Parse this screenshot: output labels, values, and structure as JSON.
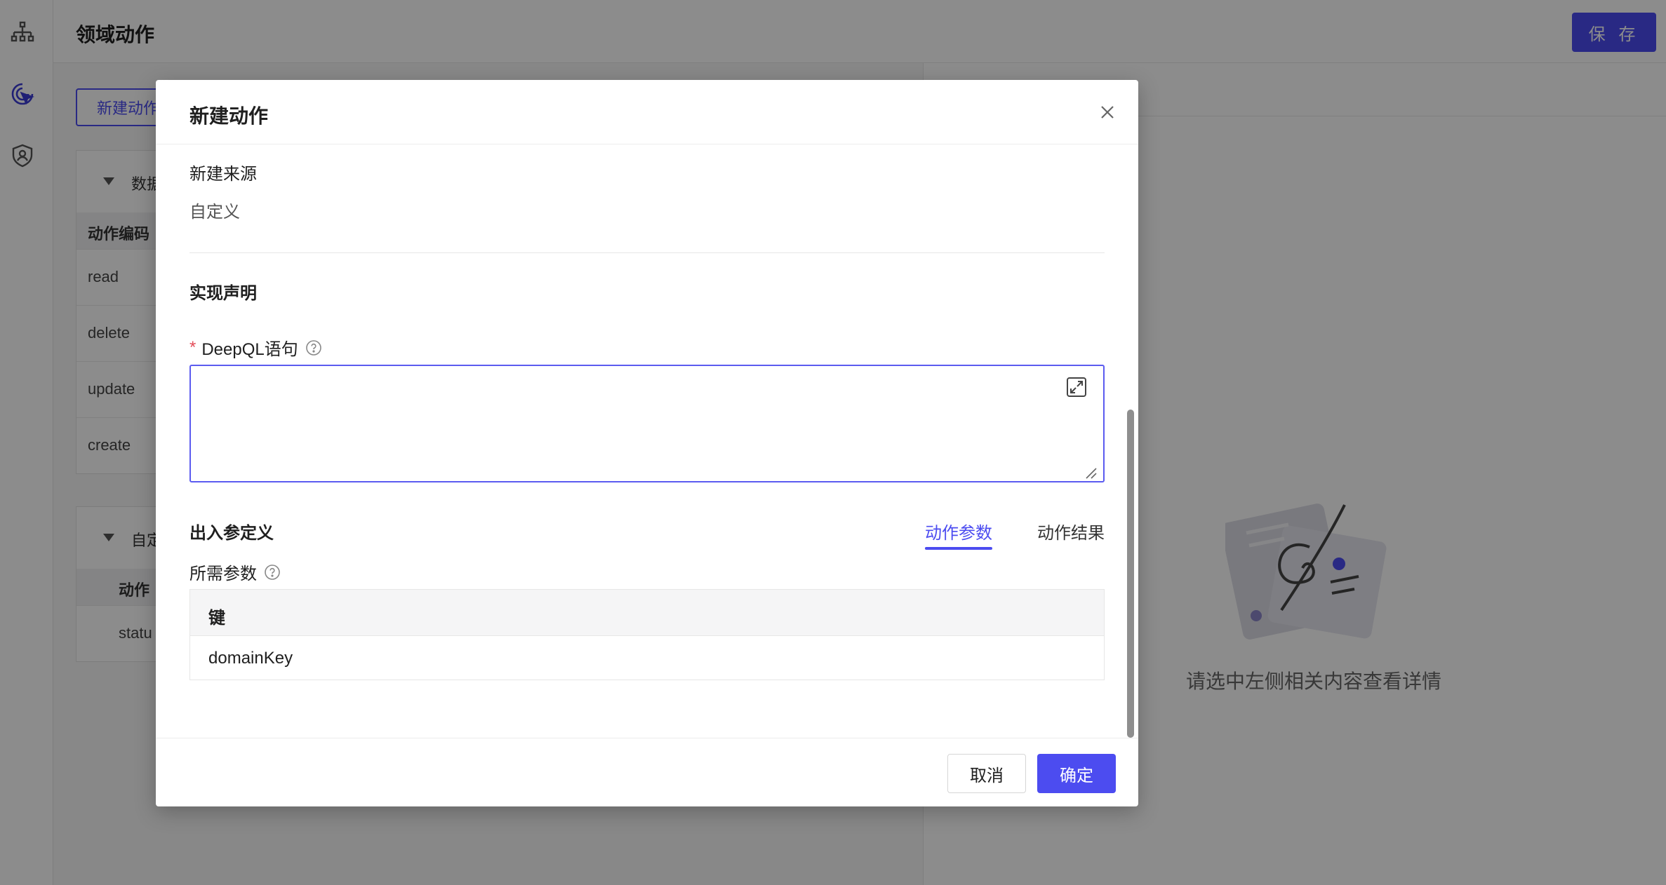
{
  "app": {
    "page_title": "领域动作",
    "save_label": "保 存",
    "new_action_label": "新建动作",
    "sidebar_icons": [
      "hierarchy-icon",
      "pointer-click-icon",
      "shield-user-icon"
    ]
  },
  "left_list": {
    "group1": {
      "title": "数据",
      "column": "动作编码",
      "rows": [
        "read",
        "delete",
        "update",
        "create"
      ]
    },
    "group2": {
      "title": "自定",
      "column": "动作",
      "rows": [
        "statu"
      ]
    }
  },
  "right_panel": {
    "empty_text": "请选中左侧相关内容查看详情"
  },
  "modal": {
    "title": "新建动作",
    "source_label": "新建来源",
    "source_value": "自定义",
    "impl_section": "实现声明",
    "required_mark": "*",
    "ql_label": "DeepQL语句",
    "ql_value": "",
    "io_section": "出入参定义",
    "tabs": [
      {
        "label": "动作参数",
        "active": true
      },
      {
        "label": "动作结果",
        "active": false
      }
    ],
    "params_label": "所需参数",
    "table": {
      "header": "键",
      "rows": [
        "domainKey"
      ]
    },
    "cancel_label": "取消",
    "ok_label": "确定"
  },
  "colors": {
    "primary": "#4c4cf0",
    "required": "#e34d59"
  }
}
